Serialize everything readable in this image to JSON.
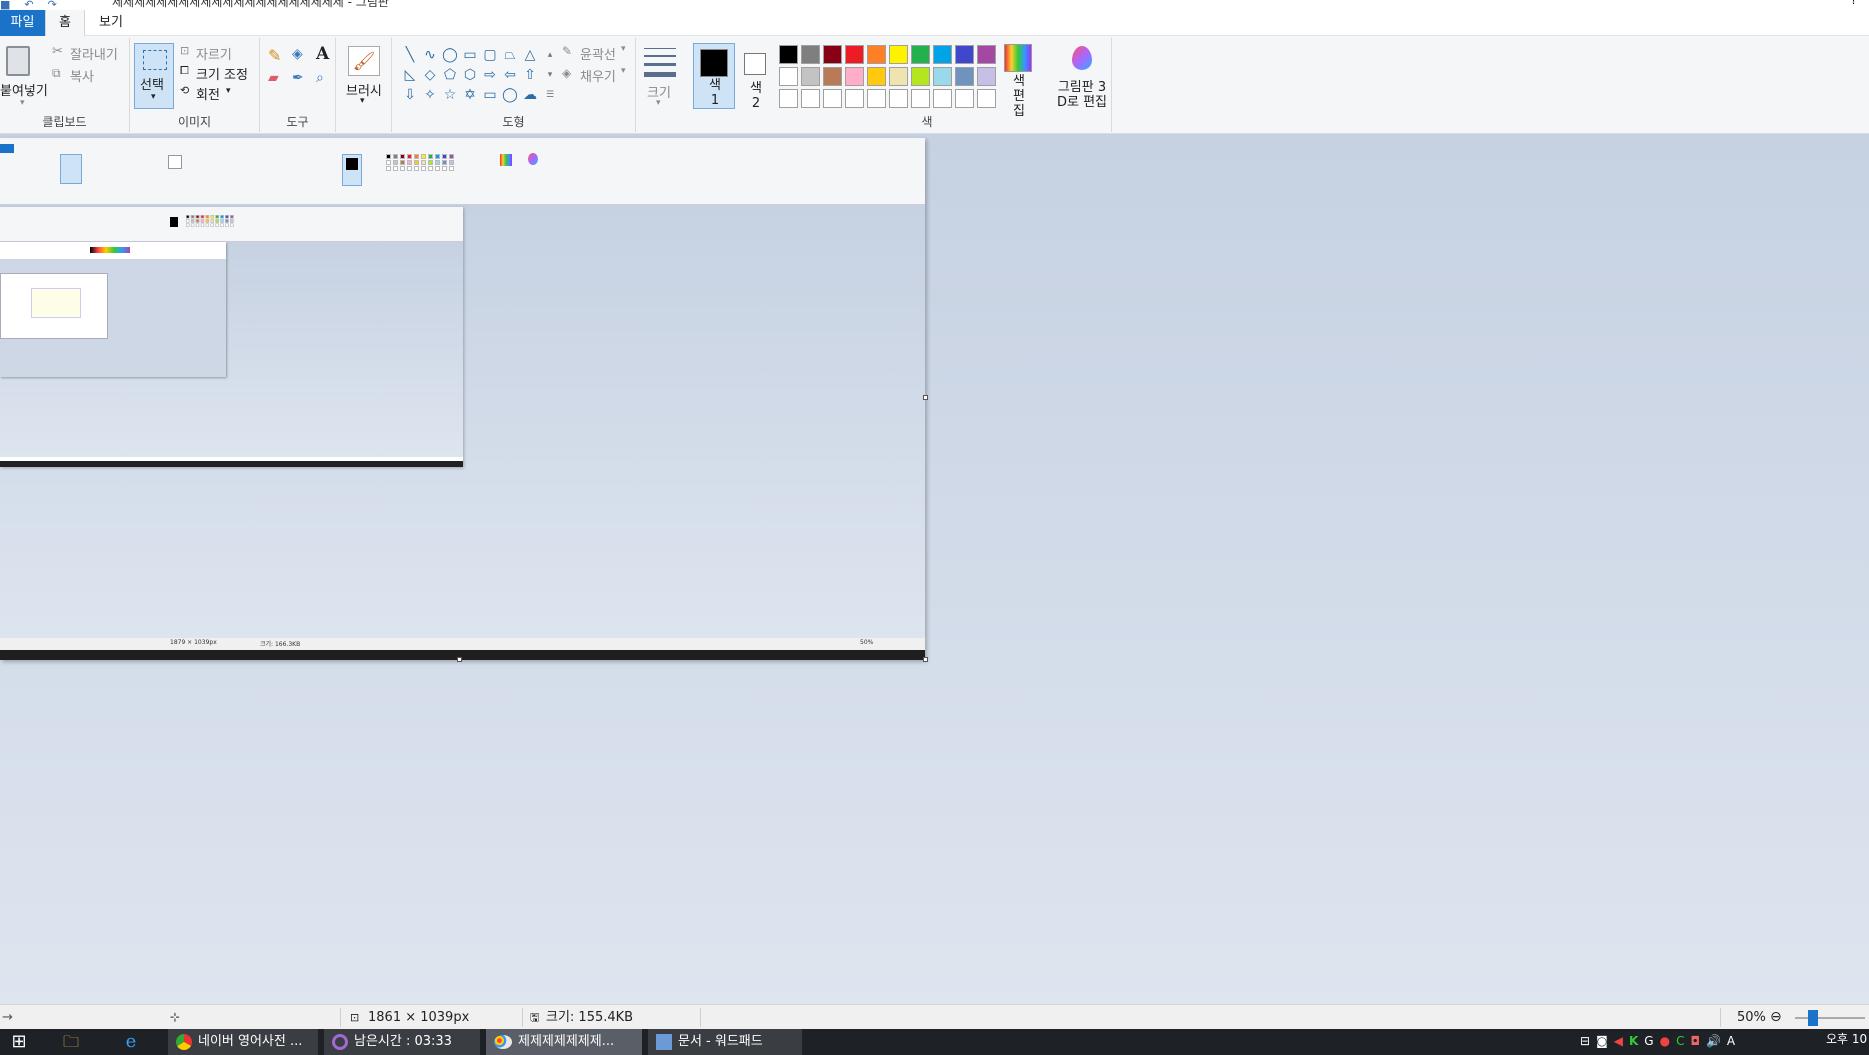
{
  "window": {
    "title": "제제제제제제제제제제제제제제제제제제제제제 - 그림판"
  },
  "menu": {
    "file": "파일",
    "home": "홈",
    "view": "보기"
  },
  "ribbon": {
    "clipboard": {
      "paste": "붙여넣기",
      "cut": "잘라내기",
      "copy": "복사",
      "label": "클립보드"
    },
    "image": {
      "select": "선택",
      "crop": "자르기",
      "resize": "크기 조정",
      "rotate": "회전",
      "label": "이미지"
    },
    "tools": {
      "label": "도구",
      "text_glyph": "A"
    },
    "brushes": {
      "label": "브러시"
    },
    "shapes": {
      "outline": "윤곽선",
      "fill": "채우기",
      "label": "도형"
    },
    "size": {
      "label": "크기"
    },
    "colors": {
      "color1": "색 1",
      "color2": "색 2",
      "edit": "색 편집",
      "paint3d": "그림판 3 D로 편집",
      "label": "색",
      "palette": [
        "#000000",
        "#7f7f7f",
        "#880015",
        "#ed1c24",
        "#ff7f27",
        "#fff200",
        "#22b14c",
        "#00a2e8",
        "#3f48cc",
        "#a349a4",
        "#ffffff",
        "#c3c3c3",
        "#b97a57",
        "#ffaec9",
        "#ffc90e",
        "#efe4b0",
        "#b5e61d",
        "#99d9ea",
        "#7092be",
        "#c8bfe7",
        "#ffffff",
        "#ffffff",
        "#ffffff",
        "#ffffff",
        "#ffffff",
        "#ffffff",
        "#ffffff",
        "#ffffff",
        "#ffffff",
        "#ffffff"
      ]
    }
  },
  "nested": {
    "dims": "1879 × 1039px",
    "size": "크기: 166.3KB",
    "zoom": "50%"
  },
  "status": {
    "dims": "1861 × 1039px",
    "size": "크기: 155.4KB",
    "zoom": "50%"
  },
  "taskbar": {
    "items": [
      "네이버 영어사전 ...",
      "남은시간 : 03:33",
      "제제제제제제제...",
      "문서 - 워드패드"
    ],
    "time": "오후 10"
  }
}
